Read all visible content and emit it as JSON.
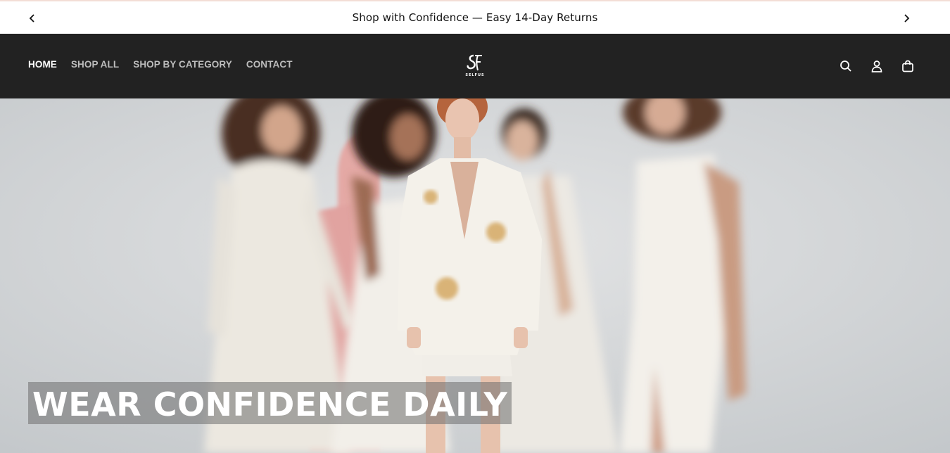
{
  "announcement": {
    "text": "Shop with Confidence — Easy 14-Day Returns",
    "prev_icon": "chevron-left-icon",
    "next_icon": "chevron-right-icon"
  },
  "header": {
    "nav": [
      {
        "label": "HOME",
        "active": true
      },
      {
        "label": "SHOP ALL",
        "active": false
      },
      {
        "label": "SHOP BY CATEGORY",
        "active": false
      },
      {
        "label": "CONTACT",
        "active": false
      }
    ],
    "logo": {
      "wordmark": "SELFUS"
    },
    "icons": [
      "search-icon",
      "account-icon",
      "cart-icon"
    ]
  },
  "hero": {
    "title": "WEAR CONFIDENCE DAILY"
  },
  "colors": {
    "header_bg": "#222222",
    "nav_active": "#ffffff",
    "nav_inactive": "#bdbdbd",
    "accent_pink": "#e8aeaa"
  }
}
